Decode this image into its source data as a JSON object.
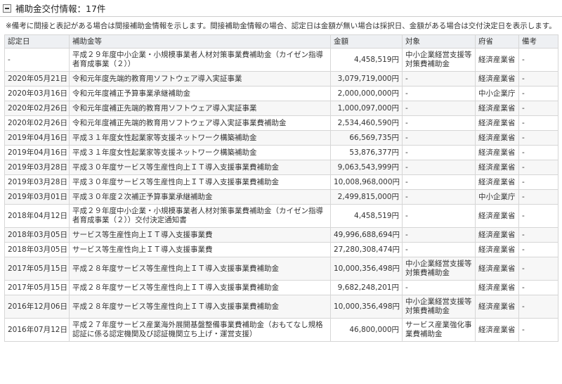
{
  "header": {
    "title": "補助金交付情報：17件"
  },
  "note": "※備考に間接と表記がある場合は間接補助金情報を示します。間接補助金情報の場合、認定日は金額が無い場合は採択日、金額がある場合は交付決定日を表示します。",
  "table": {
    "columns": [
      "認定日",
      "補助金等",
      "金額",
      "対象",
      "府省",
      "備考"
    ],
    "rows": [
      {
        "date": "-",
        "name": "平成２９年度中小企業・小規模事業者人材対策事業費補助金（カイゼン指導者育成事業（２））",
        "amount": "4,458,519円",
        "target": "中小企業経営支援等対策費補助金",
        "ministry": "経済産業省",
        "remarks": "-"
      },
      {
        "date": "2020年05月21日",
        "name": "令和元年度先端的教育用ソフトウェア導入実証事業",
        "amount": "3,079,719,000円",
        "target": "-",
        "ministry": "経済産業省",
        "remarks": "-"
      },
      {
        "date": "2020年03月16日",
        "name": "令和元年度補正予算事業承継補助金",
        "amount": "2,000,000,000円",
        "target": "-",
        "ministry": "中小企業庁",
        "remarks": "-"
      },
      {
        "date": "2020年02月26日",
        "name": "令和元年度補正先端的教育用ソフトウェア導入実証事業",
        "amount": "1,000,097,000円",
        "target": "-",
        "ministry": "経済産業省",
        "remarks": "-"
      },
      {
        "date": "2020年02月26日",
        "name": "令和元年度補正先端的教育用ソフトウェア導入実証事業費補助金",
        "amount": "2,534,460,590円",
        "target": "-",
        "ministry": "経済産業省",
        "remarks": "-"
      },
      {
        "date": "2019年04月16日",
        "name": "平成３１年度女性起業家等支援ネットワーク構築補助金",
        "amount": "66,569,735円",
        "target": "-",
        "ministry": "経済産業省",
        "remarks": "-"
      },
      {
        "date": "2019年04月16日",
        "name": "平成３１年度女性起業家等支援ネットワーク構築補助金",
        "amount": "53,876,377円",
        "target": "-",
        "ministry": "経済産業省",
        "remarks": "-"
      },
      {
        "date": "2019年03月28日",
        "name": "平成３０年度サービス等生産性向上ＩＴ導入支援事業費補助金",
        "amount": "9,063,543,999円",
        "target": "-",
        "ministry": "経済産業省",
        "remarks": "-"
      },
      {
        "date": "2019年03月28日",
        "name": "平成３０年度サービス等生産性向上ＩＴ導入支援事業費補助金",
        "amount": "10,008,968,000円",
        "target": "-",
        "ministry": "経済産業省",
        "remarks": "-"
      },
      {
        "date": "2019年03月01日",
        "name": "平成３０年度２次補正予算事業承継補助金",
        "amount": "2,499,815,000円",
        "target": "-",
        "ministry": "中小企業庁",
        "remarks": "-"
      },
      {
        "date": "2018年04月12日",
        "name": "平成２９年度中小企業・小規模事業者人材対策事業費補助金（カイゼン指導者育成事業（２））交付決定通知書",
        "amount": "4,458,519円",
        "target": "-",
        "ministry": "経済産業省",
        "remarks": "-"
      },
      {
        "date": "2018年03月05日",
        "name": "サービス等生産性向上ＩＴ導入支援事業費",
        "amount": "49,996,688,694円",
        "target": "-",
        "ministry": "経済産業省",
        "remarks": "-"
      },
      {
        "date": "2018年03月05日",
        "name": "サービス等生産性向上ＩＴ導入支援事業費",
        "amount": "27,280,308,474円",
        "target": "-",
        "ministry": "経済産業省",
        "remarks": "-"
      },
      {
        "date": "2017年05月15日",
        "name": "平成２８年度サービス等生産性向上ＩＴ導入支援事業費補助金",
        "amount": "10,000,356,498円",
        "target": "中小企業経営支援等対策費補助金",
        "ministry": "経済産業省",
        "remarks": "-"
      },
      {
        "date": "2017年05月15日",
        "name": "平成２８年度サービス等生産性向上ＩＴ導入支援事業費補助金",
        "amount": "9,682,248,201円",
        "target": "-",
        "ministry": "経済産業省",
        "remarks": "-"
      },
      {
        "date": "2016年12月06日",
        "name": "平成２８年度サービス等生産性向上ＩＴ導入支援事業費補助金",
        "amount": "10,000,356,498円",
        "target": "中小企業経営支援等対策費補助金",
        "ministry": "経済産業省",
        "remarks": "-"
      },
      {
        "date": "2016年07月12日",
        "name": "平成２７年度サービス産業海外展開基盤整備事業費補助金（おもてなし規格認証に係る認定機関及び認証機関立ち上げ・運営支援）",
        "amount": "46,800,000円",
        "target": "サービス産業強化事業費補助金",
        "ministry": "経済産業省",
        "remarks": "-"
      }
    ]
  }
}
